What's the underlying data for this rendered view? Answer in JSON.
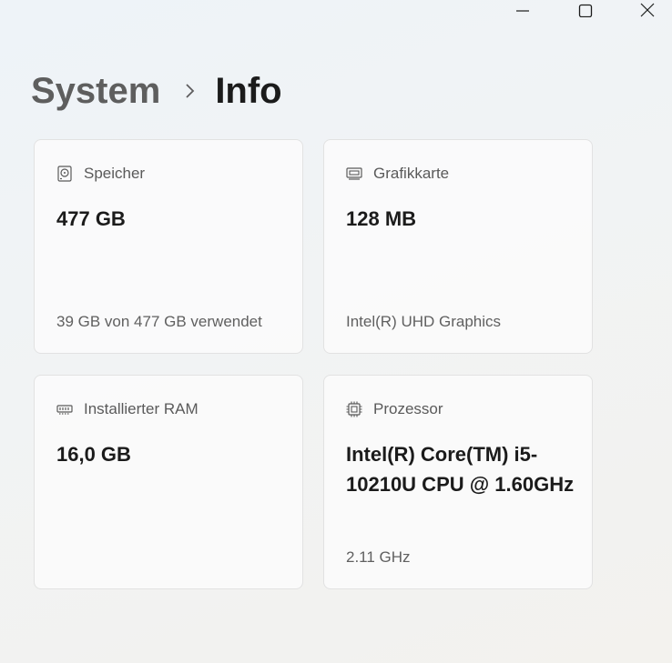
{
  "window_controls": {
    "minimize": "minimize-icon",
    "maximize": "maximize-icon",
    "close": "close-icon"
  },
  "breadcrumb": {
    "parent": "System",
    "current": "Info"
  },
  "cards": [
    {
      "icon": "hard-drive-icon",
      "title": "Speicher",
      "value": "477 GB",
      "detail": "39 GB von 477 GB verwendet"
    },
    {
      "icon": "graphics-card-icon",
      "title": "Grafikkarte",
      "value": "128 MB",
      "detail": "Intel(R) UHD Graphics"
    },
    {
      "icon": "memory-icon",
      "title": "Installierter RAM",
      "value": "16,0 GB",
      "detail": ""
    },
    {
      "icon": "processor-icon",
      "title": "Prozessor",
      "value": "Intel(R) Core(TM) i5-10210U CPU @ 1.60GHz",
      "detail": "2.11 GHz"
    }
  ]
}
